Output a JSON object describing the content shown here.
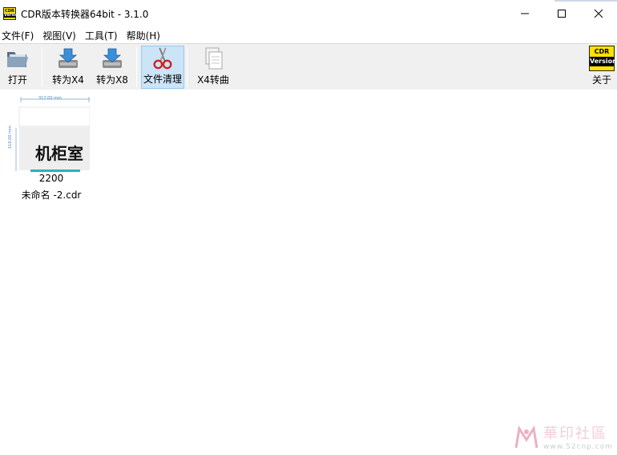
{
  "window": {
    "title": "CDR版本转换器64bit - 3.1.0",
    "icon": "cdr-version-icon",
    "icon_text_top": "CDR",
    "icon_text_bottom": "Version"
  },
  "menu": {
    "items": [
      {
        "label": "文件(F)"
      },
      {
        "label": "视图(V)"
      },
      {
        "label": "工具(T)"
      },
      {
        "label": "帮助(H)"
      }
    ]
  },
  "toolbar": {
    "open_label": "打开",
    "to_x4_label": "转为X4",
    "to_x8_label": "转为X8",
    "clean_label": "文件清理",
    "x4_curve_label": "X4转曲",
    "about_label": "关于",
    "badge_top": "CDR",
    "badge_bottom": "Version"
  },
  "files": [
    {
      "name_line1": "2200",
      "name_line2": "未命名 -2.cdr",
      "thumb_text": "机柜室",
      "thumb_width_dim": "317.00 mm",
      "thumb_height_dim": "110.00 mm"
    }
  ],
  "watermark": {
    "title": "華印社區",
    "url": "www.52cnp.com"
  },
  "colors": {
    "toolbar_bg": "#f0f0f0",
    "active_bg": "#cce4f7",
    "badge_yellow": "#ffe200"
  }
}
